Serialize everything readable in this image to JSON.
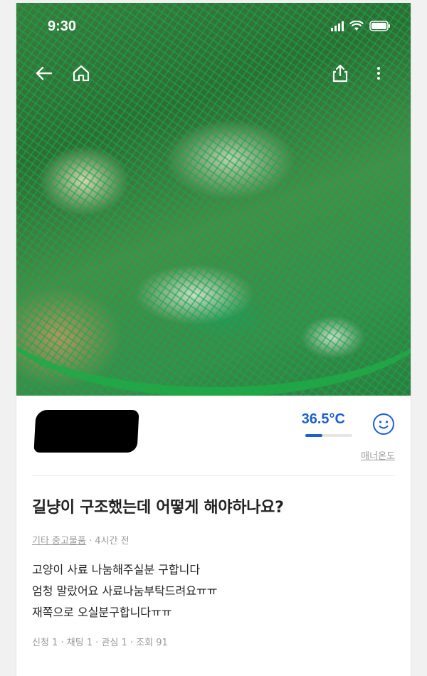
{
  "status": {
    "time": "9:30"
  },
  "hero": {
    "description_icon": "photo"
  },
  "nav": {
    "back_icon": "back-arrow-icon",
    "home_icon": "home-icon",
    "share_icon": "share-icon",
    "more_icon": "more-vertical-icon"
  },
  "profile": {
    "temperature": "36.5°C",
    "temperature_level": 0.365,
    "manner_label": "매너온도"
  },
  "post": {
    "title": "길냥이 구조했는데 어떻게 해야하나요?",
    "category": "기타 중고물품",
    "time": "· 4시간 전",
    "body": [
      "고양이 사료 나눔해주실분 구합니다",
      "엄청 말랐어요 사료나눔부탁드려요ㅠㅠ",
      "재쪽으로 오실분구합니다ㅠㅠ"
    ],
    "stats": "신청 1 · 채팅 1 · 관심 1 · 조회 91"
  },
  "colors": {
    "accent": "#1c5fd3",
    "muted": "#9a9a9a",
    "text": "#222222"
  }
}
